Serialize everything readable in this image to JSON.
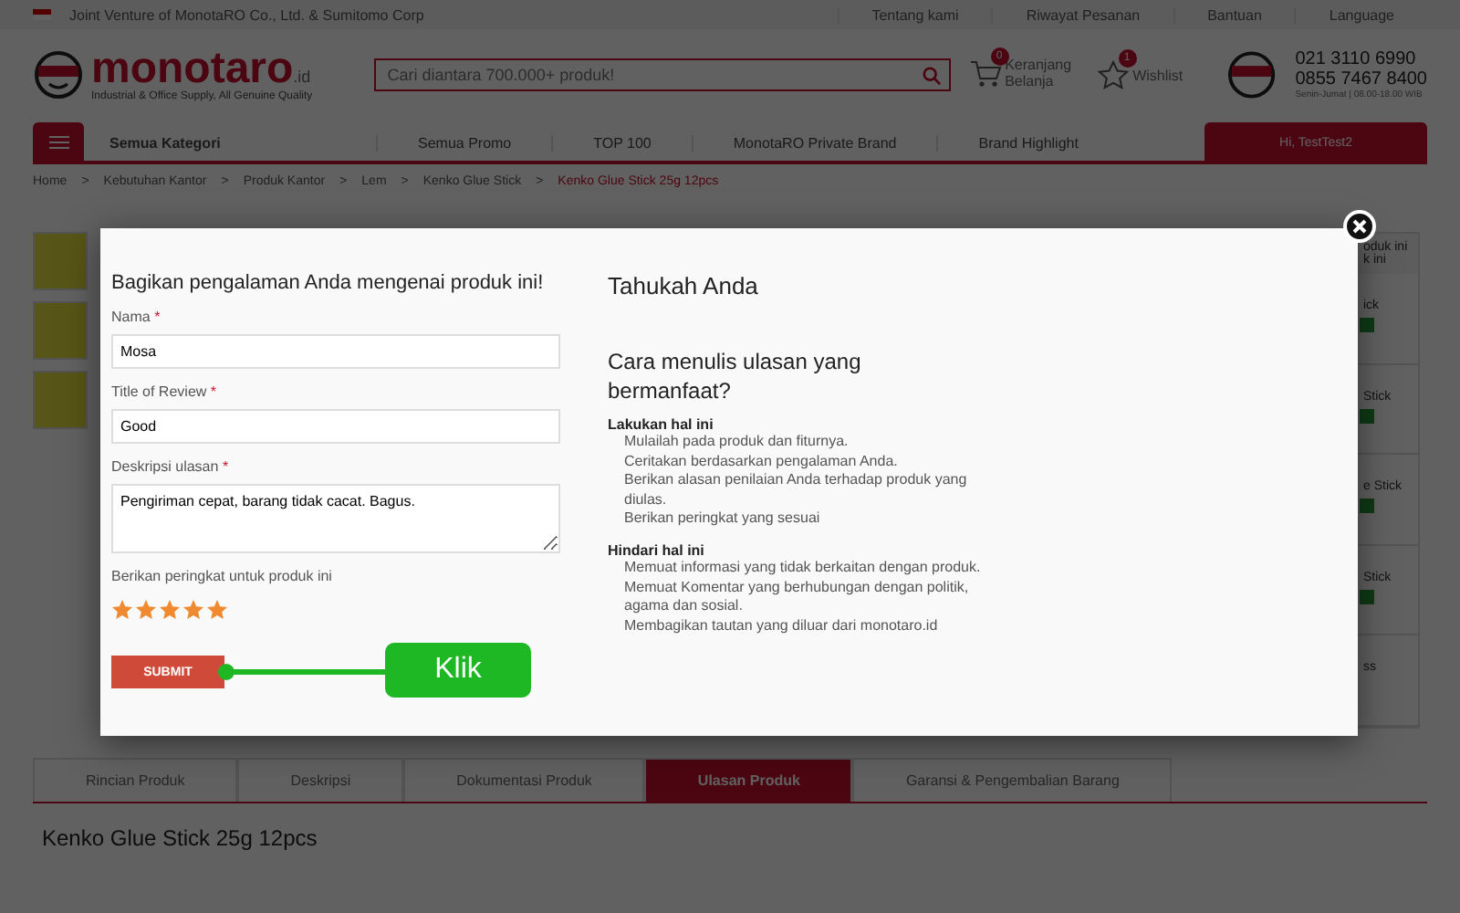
{
  "top_bar": {
    "tagline": "Joint Venture of MonotaRO Co., Ltd. & Sumitomo Corp",
    "links": [
      "Tentang kami",
      "Riwayat Pesanan",
      "Bantuan",
      "Language"
    ]
  },
  "header": {
    "logo": "monotaro",
    "logo_suffix": ".id",
    "logo_tagline": "Industrial & Office Supply, All Genuine Quality",
    "search": {
      "placeholder": "Cari diantara 700.000+ produk!"
    },
    "cart": {
      "label": "Keranjang Belanja",
      "count": "0"
    },
    "wishlist": {
      "label": "Wishlist",
      "count": "1"
    },
    "phones": [
      "021 3110 6990",
      "0855 7467 8400"
    ],
    "hours": "Senin-Jumat | 08.00-18.00 WIB"
  },
  "nav": {
    "category": "Semua Kategori",
    "items": [
      "Semua Promo",
      "TOP 100",
      "MonotaRO Private Brand",
      "Brand Highlight"
    ],
    "user": "Hi, TestTest2"
  },
  "breadcrumb_separator": ">",
  "breadcrumb": [
    "Home",
    "Kebutuhan Kantor",
    "Produk Kantor",
    "Lem",
    "Kenko Glue Stick",
    "Kenko Glue Stick 25g 12pcs"
  ],
  "side_list": {
    "header": [
      "oduk ini",
      "k ini"
    ],
    "items": [
      "ick",
      "Stick",
      "e Stick",
      "Stick"
    ],
    "footer": "ss"
  },
  "modal": {
    "form": {
      "title": "Bagikan pengalaman Anda mengenai produk ini!",
      "required_mark": "*",
      "fields": [
        {
          "label": "Nama",
          "required": true,
          "value": "Mosa",
          "kind": "input"
        },
        {
          "label": "Title of Review",
          "required": true,
          "value": "Good",
          "kind": "input"
        },
        {
          "label": "Deskripsi ulasan",
          "required": true,
          "value": "Pengiriman cepat, barang tidak cacat. Bagus.",
          "kind": "textarea"
        }
      ],
      "rating_label": "Berikan peringkat untuk produk ini",
      "stars": 5,
      "submit": "SUBMIT",
      "callout": "Klik"
    },
    "tips": {
      "title": "Tahukah Anda",
      "subtitle": "Cara menulis ulasan yang bermanfaat?",
      "sections": [
        {
          "heading": "Lakukan hal ini",
          "items": [
            "Mulailah pada produk dan fiturnya.",
            "Ceritakan berdasarkan pengalaman Anda.",
            "Berikan alasan penilaian Anda terhadap produk yang diulas.",
            "Berikan peringkat yang sesuai"
          ]
        },
        {
          "heading": "Hindari hal ini",
          "items": [
            "Memuat informasi yang tidak berkaitan dengan produk.",
            "Memuat Komentar yang berhubungan dengan politik, agama dan sosial.",
            "Membagikan tautan yang diluar dari monotaro.id"
          ]
        }
      ]
    }
  },
  "tabs": [
    {
      "label": "Rincian Produk",
      "selected": false
    },
    {
      "label": "Deskripsi",
      "selected": false
    },
    {
      "label": "Dokumentasi Produk",
      "selected": false
    },
    {
      "label": "Ulasan Produk",
      "selected": true
    },
    {
      "label": "Garansi & Pengembalian Barang",
      "selected": false
    }
  ],
  "product_title": "Kenko Glue Stick 25g 12pcs"
}
